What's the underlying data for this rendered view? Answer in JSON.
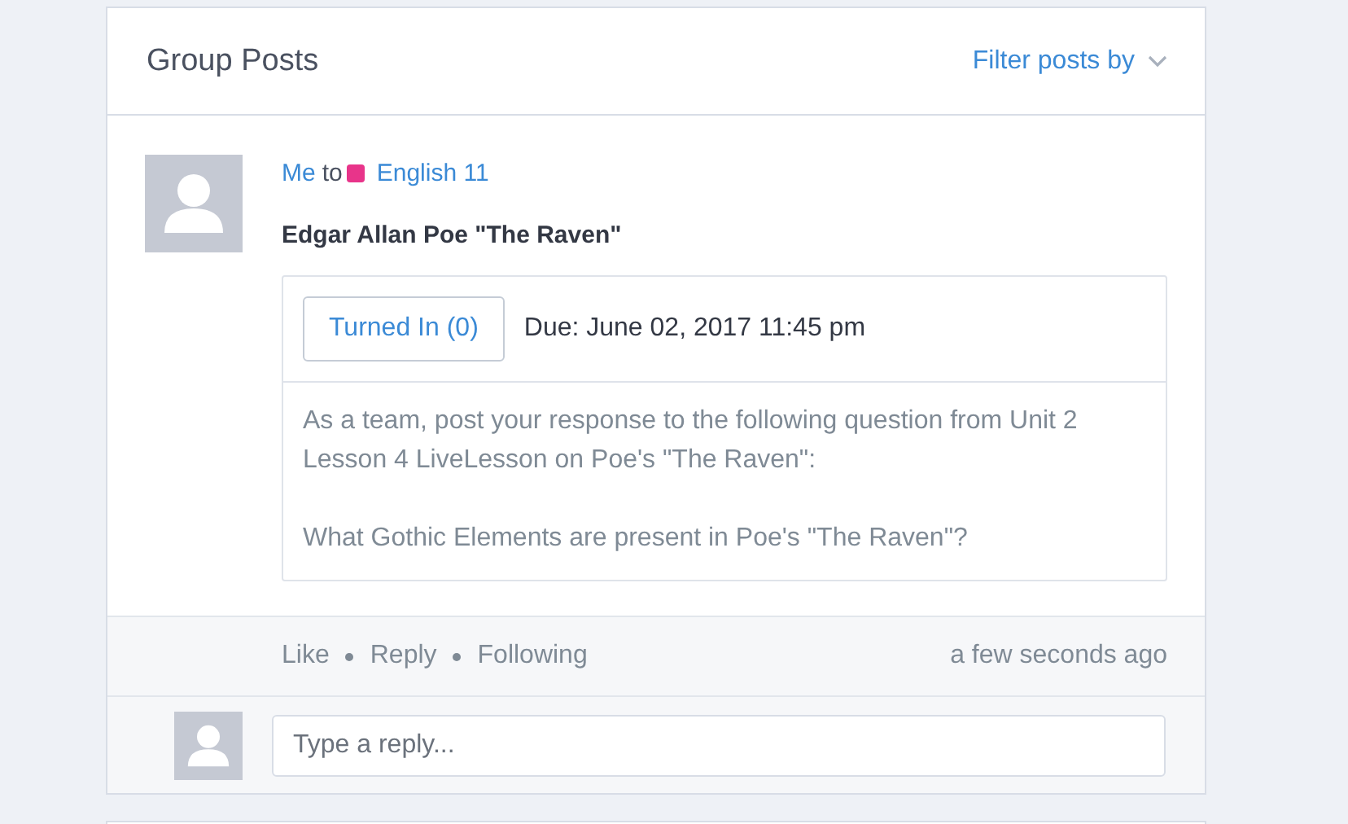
{
  "header": {
    "title": "Group Posts",
    "filter": "Filter posts by"
  },
  "post": {
    "author": "Me",
    "to": "to",
    "group": {
      "name": "English 11",
      "color": "#e8348a"
    },
    "title": "Edgar Allan Poe \"The Raven\"",
    "turned_in": "Turned In (0)",
    "due": "Due: June 02, 2017 11:45 pm",
    "body": [
      "As a team, post your response to the following question from Unit 2 Lesson 4 LiveLesson on Poe's \"The Raven\":",
      "What Gothic Elements are present in Poe's \"The Raven\"?"
    ],
    "actions": [
      "Like",
      "Reply",
      "Following"
    ],
    "time": "a few seconds ago"
  },
  "reply": {
    "placeholder": "Type a reply..."
  }
}
